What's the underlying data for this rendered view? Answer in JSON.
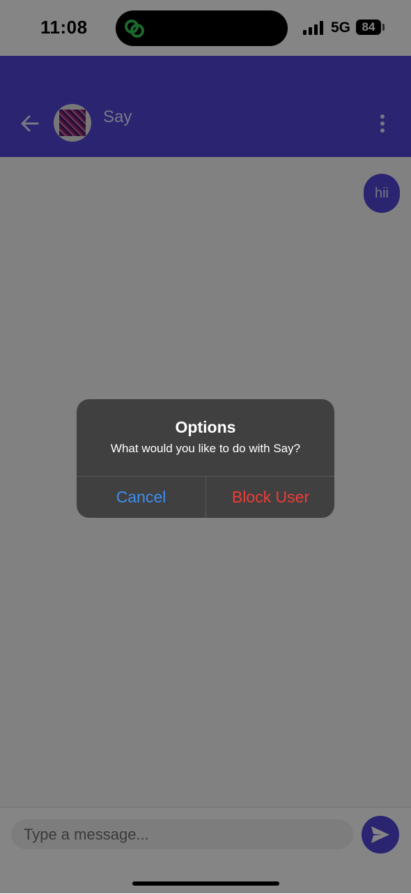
{
  "status_bar": {
    "time": "11:08",
    "network": "5G",
    "battery": "84"
  },
  "header": {
    "contact_name": "Say",
    "icons": {
      "back": "arrow-left-icon",
      "avatar": "avatar-image",
      "more": "more-vertical-icon"
    }
  },
  "messages": [
    {
      "direction": "outgoing",
      "text": "hii"
    }
  ],
  "composer": {
    "placeholder": "Type a message...",
    "send_icon": "send-icon"
  },
  "dialog": {
    "title": "Options",
    "message": "What would you like to do with Say?",
    "cancel_label": "Cancel",
    "block_label": "Block User"
  },
  "colors": {
    "brand": "#5146d9",
    "cancel": "#3d8ef0",
    "destructive": "#ef3c36",
    "dialog_bg": "#404040",
    "island_icon": "#34c759"
  }
}
